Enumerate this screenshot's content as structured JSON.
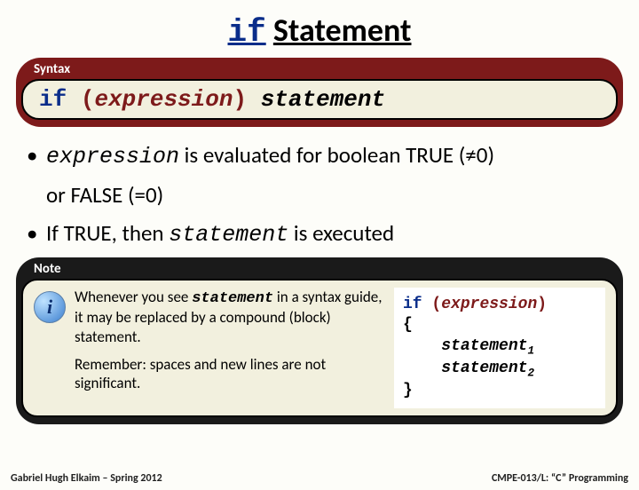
{
  "title": {
    "keyword": "if",
    "rest": "Statement"
  },
  "syntax": {
    "label": "Syntax",
    "keyword": "if",
    "open": "(",
    "expression": "expression",
    "close": ")",
    "statement": "statement"
  },
  "bullets": {
    "b1_expr": "expression",
    "b1_text1": " is evaluated for boolean TRUE (≠0)",
    "b1_text2": "or FALSE (=0)",
    "b2_text1": "If TRUE, then ",
    "b2_stmt": "statement",
    "b2_text2": " is executed"
  },
  "note": {
    "label": "Note",
    "p1a": "Whenever you see ",
    "p1_mono": "statement",
    "p1b": " in a syntax guide, it may be replaced by a compound (block) statement.",
    "p2": "Remember: spaces and new lines are not significant.",
    "code": {
      "kw": "if",
      "open": "(",
      "expr": "expression",
      "close": ")",
      "brace_open": "{",
      "stmt": "statement",
      "sub1": "1",
      "sub2": "2",
      "brace_close": "}"
    }
  },
  "footer": {
    "left": "Gabriel Hugh Elkaim – Spring 2012",
    "right": "CMPE-013/L: “C” Programming"
  }
}
